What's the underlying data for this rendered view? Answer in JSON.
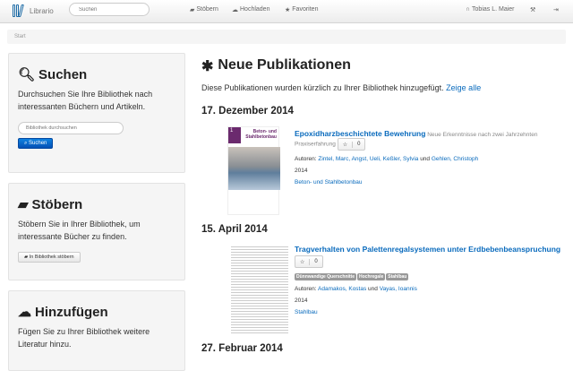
{
  "nav": {
    "brand": "Librario",
    "search_placeholder": "Suchen",
    "links": [
      {
        "label": "Stöbern",
        "icon": "book-icon"
      },
      {
        "label": "Hochladen",
        "icon": "cloud-upload-icon"
      },
      {
        "label": "Favoriten",
        "icon": "star-icon"
      }
    ],
    "user": "Tobias L. Maier"
  },
  "breadcrumb": "Start",
  "sidebar": {
    "search": {
      "title": "Suchen",
      "text": "Durchsuchen Sie Ihre Bibliothek nach interessanten Büchern und Artikeln.",
      "placeholder": "Bibliothek durchsuchen",
      "button": "Suchen"
    },
    "browse": {
      "title": "Stöbern",
      "text": "Stöbern Sie in Ihrer Bibliothek, um interessante Bücher zu finden.",
      "button": "In Bibliothek stöbern"
    },
    "add": {
      "title": "Hinzufügen",
      "text": "Fügen Sie zu Ihrer Bibliothek weitere Literatur hinzu."
    }
  },
  "main": {
    "title": "Neue Publikationen",
    "desc": "Diese Publikationen wurden kürzlich zu Ihrer Bibliothek hinzugefügt.",
    "show_all": "Zeige alle",
    "groups": [
      {
        "date": "17. Dezember 2014",
        "pub": {
          "title": "Epoxidharzbeschichtete Bewehrung",
          "subtitle": "Neue Erkenntnisse nach zwei Jahrzehnten Praxiserfahrung",
          "stars": "0",
          "authors_label": "Autoren:",
          "authors": "Zintel, Marc, Angst, Ueli, Keßler, Sylvia",
          "and": "und",
          "last_author": "Gehlen, Christoph",
          "year": "2014",
          "journal": "Beton- und Stahlbetonbau",
          "cover_title": "Beton- und Stahlbetonbau",
          "cover_num": "1"
        }
      },
      {
        "date": "15. April 2014",
        "pub": {
          "title": "Tragverhalten von Palettenregalsystemen unter Erdbebenbeanspruchung",
          "stars": "0",
          "tags": [
            "Dünnwandige Querschnitte",
            "Hochregale",
            "Stahlbau"
          ],
          "authors_label": "Autoren:",
          "authors": "Adamakos, Kostas",
          "and": "und",
          "last_author": "Vayas, Ioannis",
          "year": "2014",
          "journal": "Stahlbau"
        }
      },
      {
        "date": "27. Februar 2014"
      }
    ]
  }
}
